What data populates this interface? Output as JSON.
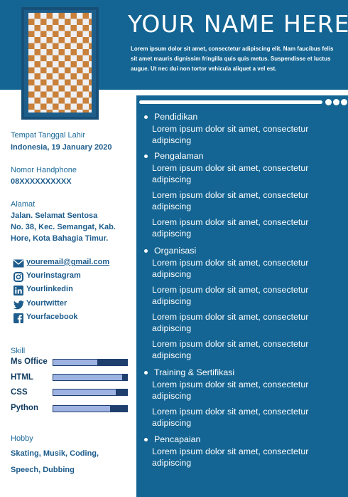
{
  "header": {
    "name": "YOUR NAME HERE",
    "intro": "Lorem ipsum dolor sit amet, consectetur adipiscing elit. Nam faucibus felis sit amet mauris dignissim fringilla quis quis metus. Suspendisse et luctus augue. Ut nec dui non tortor vehicula aliquet a vel est."
  },
  "personal": {
    "birth_label": "Tempat Tanggal Lahir",
    "birth_value": "Indonesia, 19 January 2020",
    "phone_label": "Nomor Handphone",
    "phone_value": "08XXXXXXXXXX",
    "address_label": "Alamat",
    "address_line1": "Jalan. Selamat Sentosa",
    "address_line2": "No. 38, Kec. Semangat, Kab.",
    "address_line3": "Hore, Kota Bahagia Timur."
  },
  "contacts": [
    {
      "icon": "mail-icon",
      "text": "youremail@gmail.com"
    },
    {
      "icon": "instagram-icon",
      "text": "Yourinstagram"
    },
    {
      "icon": "linkedin-icon",
      "text": "Yourlinkedin"
    },
    {
      "icon": "twitter-icon",
      "text": "Yourtwitter"
    },
    {
      "icon": "facebook-icon",
      "text": "Yourfacebook"
    }
  ],
  "skills": {
    "label": "Skill",
    "items": [
      {
        "name": "Ms Office",
        "level": 0.6
      },
      {
        "name": "HTML",
        "level": 0.93
      },
      {
        "name": "CSS",
        "level": 0.85
      },
      {
        "name": "Python",
        "level": 0.77
      }
    ]
  },
  "hobby": {
    "label": "Hobby",
    "line1": "Skating, Musik, Coding,",
    "line2": "Speech, Dubbing"
  },
  "sections": [
    {
      "title": "Pendidikan",
      "entries": [
        "Lorem ipsum dolor sit amet, consectetur adipiscing"
      ]
    },
    {
      "title": "Pengalaman",
      "entries": [
        "Lorem ipsum dolor sit amet, consectetur adipiscing",
        "Lorem ipsum dolor sit amet, consectetur adipiscing",
        "Lorem ipsum dolor sit amet, consectetur adipiscing"
      ]
    },
    {
      "title": "Organisasi",
      "entries": [
        "Lorem ipsum dolor sit amet, consectetur adipiscing",
        "Lorem ipsum dolor sit amet, consectetur adipiscing",
        "Lorem ipsum dolor sit amet, consectetur adipiscing",
        "Lorem ipsum dolor sit amet, consectetur adipiscing"
      ]
    },
    {
      "title": "Training & Sertifikasi",
      "entries": [
        "Lorem ipsum dolor sit amet, consectetur adipiscing",
        "Lorem ipsum dolor sit amet, consectetur adipiscing"
      ]
    },
    {
      "title": "Pencapaian",
      "entries": [
        "Lorem ipsum dolor sit amet, consectetur adipiscing"
      ]
    }
  ],
  "colors": {
    "primary": "#146593",
    "accent_photo": "#c8803a",
    "skill_fill": "#9fb3e2",
    "skill_track": "#1f3f6e"
  }
}
